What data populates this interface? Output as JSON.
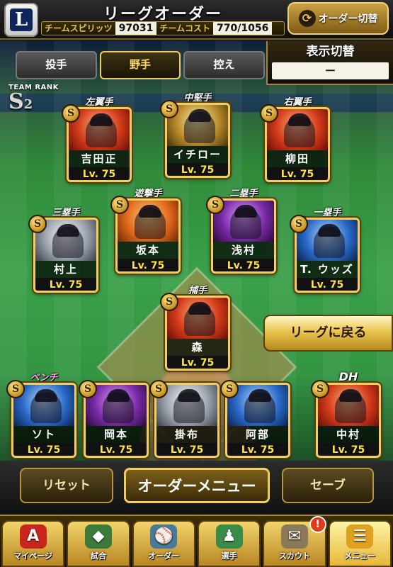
{
  "header": {
    "title": "リーグオーダー",
    "team_logo_letter": "L",
    "spirit_label": "チームスピリッツ",
    "spirit_value": "97031",
    "cost_label": "チームコスト",
    "cost_value": "770/1056",
    "order_swap_label": "オーダー切替",
    "order_swap_icon": "swap-arrows-icon"
  },
  "tabs": [
    {
      "label": "投手",
      "active": false
    },
    {
      "label": "野手",
      "active": true
    },
    {
      "label": "控え",
      "active": false
    }
  ],
  "display_toggle": {
    "label": "表示切替",
    "value": "ー"
  },
  "team_rank": {
    "label": "TEAM RANK",
    "rank": "S",
    "sub": "2"
  },
  "positions": [
    {
      "pos": "左翼手",
      "name": "吉田正",
      "level": "Lv. 75",
      "badge": "S"
    },
    {
      "pos": "中堅手",
      "name": "イチロー",
      "level": "Lv. 75",
      "badge": "S"
    },
    {
      "pos": "右翼手",
      "name": "柳田",
      "level": "Lv. 75",
      "badge": "S"
    },
    {
      "pos": "遊撃手",
      "name": "坂本",
      "level": "Lv. 75",
      "badge": "S"
    },
    {
      "pos": "二塁手",
      "name": "浅村",
      "level": "Lv. 75",
      "badge": "S"
    },
    {
      "pos": "三塁手",
      "name": "村上",
      "level": "Lv. 75",
      "badge": "S"
    },
    {
      "pos": "一塁手",
      "name": "T. ウッズ",
      "level": "Lv. 75",
      "badge": "S"
    },
    {
      "pos": "捕手",
      "name": "森",
      "level": "Lv. 75",
      "badge": "S"
    }
  ],
  "bench": {
    "label": "ベンチ",
    "players": [
      {
        "name": "ソト",
        "level": "Lv. 75",
        "badge": "S"
      },
      {
        "name": "岡本",
        "level": "Lv. 75",
        "badge": "S"
      },
      {
        "name": "掛布",
        "level": "Lv. 75",
        "badge": "S"
      },
      {
        "name": "阿部",
        "level": "Lv. 75",
        "badge": "S"
      }
    ]
  },
  "dh": {
    "pos": "DH",
    "name": "中村",
    "level": "Lv. 75",
    "badge": "S"
  },
  "back_to_league": "リーグに戻る",
  "controls": {
    "reset": "リセット",
    "order_menu": "オーダーメニュー",
    "save": "セーブ"
  },
  "tabbar": [
    {
      "label": "マイページ",
      "icon": "A"
    },
    {
      "label": "試合",
      "icon": "◆"
    },
    {
      "label": "オーダー",
      "icon": "⚾"
    },
    {
      "label": "選手",
      "icon": "♟"
    },
    {
      "label": "スカウト",
      "icon": "✉",
      "alert": "!"
    },
    {
      "label": "メニュー",
      "icon": "☰"
    }
  ],
  "colors": {
    "accent_gold": "#f0cf63",
    "level_yellow": "#ffe14a",
    "bench_pink": "#ff9ee6"
  }
}
